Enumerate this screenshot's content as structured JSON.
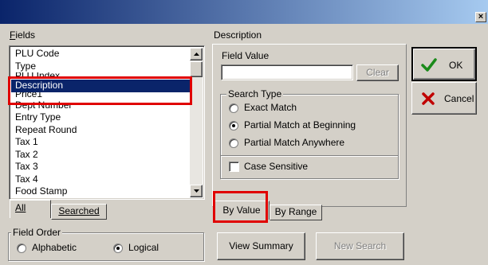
{
  "titlebar": {
    "close_glyph": "×"
  },
  "fields": {
    "label": "Fields",
    "items": [
      "PLU Code",
      "Type",
      "PLU Index",
      "Description",
      "Price1",
      "Dept Number",
      "Entry Type",
      "Repeat Round",
      "Tax 1",
      "Tax 2",
      "Tax 3",
      "Tax 4",
      "Food Stamp"
    ],
    "selected_index": 3,
    "tabs": [
      {
        "label": "All",
        "active": true
      },
      {
        "label": "Searched",
        "active": false
      }
    ]
  },
  "field_order": {
    "title": "Field Order",
    "options": [
      {
        "label": "Alphabetic",
        "checked": false
      },
      {
        "label": "Logical",
        "checked": true
      }
    ]
  },
  "description_panel": {
    "title": "Description",
    "field_value_label": "Field Value",
    "field_value": "",
    "clear_label": "Clear",
    "search_type": {
      "title": "Search Type",
      "options": [
        {
          "label": "Exact Match",
          "checked": false
        },
        {
          "label": "Partial Match at Beginning",
          "checked": true
        },
        {
          "label": "Partial Match Anywhere",
          "checked": false
        }
      ]
    },
    "case_sensitive": {
      "label": "Case Sensitive",
      "checked": false
    },
    "tabs": [
      {
        "label": "By Value",
        "active": true
      },
      {
        "label": "By Range",
        "active": false
      }
    ]
  },
  "buttons": {
    "ok": "OK",
    "cancel": "Cancel",
    "view_summary": "View Summary",
    "new_search": "New Search"
  },
  "colors": {
    "selection": "#0a246a",
    "highlight_box": "#e00000",
    "ok_check": "#1a8a1a",
    "cancel_x": "#c00000"
  }
}
